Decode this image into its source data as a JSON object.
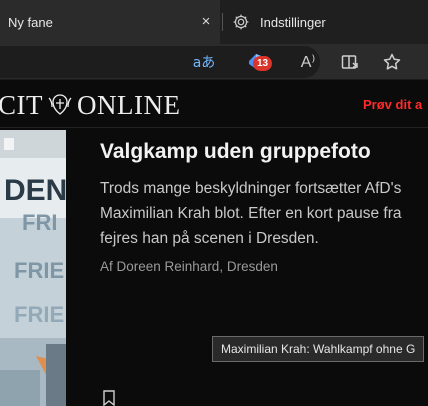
{
  "tabs": {
    "active_title": "Ny fane",
    "close_symbol": "×",
    "inactive_title": "Indstillinger",
    "inactive_icon": "gear-icon"
  },
  "toolbar": {
    "translate_glyph": "aあ",
    "translate_icon": "translate-icon",
    "extension_icon": "extension-icon",
    "extension_badge": "13",
    "read_aloud_glyph": "A⁾",
    "read_aloud_icon": "read-aloud-icon",
    "split_screen_icon": "split-screen-icon",
    "favorite_icon": "star-icon",
    "accent_color": "#6fb8ff",
    "badge_color": "#d9352b"
  },
  "page": {
    "logo_left": "CIT",
    "logo_right": "ONLINE",
    "promo": "Prøv dit a",
    "promo_color": "#ff2a2a",
    "headline": "Valgkamp uden gruppefoto",
    "teaser_lines": [
      "Trods mange beskyldninger fortsætter AfD's",
      "Maximilian Krah blot. Efter en kort pause fra",
      "fejres han på scenen i Dresden."
    ],
    "byline": "Af Doreen Reinhard, Dresden",
    "tooltip": "Maximilian Krah: Wahlkampf ohne G",
    "photo_letters": [
      "DEN",
      "FRI",
      "FRIE",
      "FRIE"
    ]
  }
}
